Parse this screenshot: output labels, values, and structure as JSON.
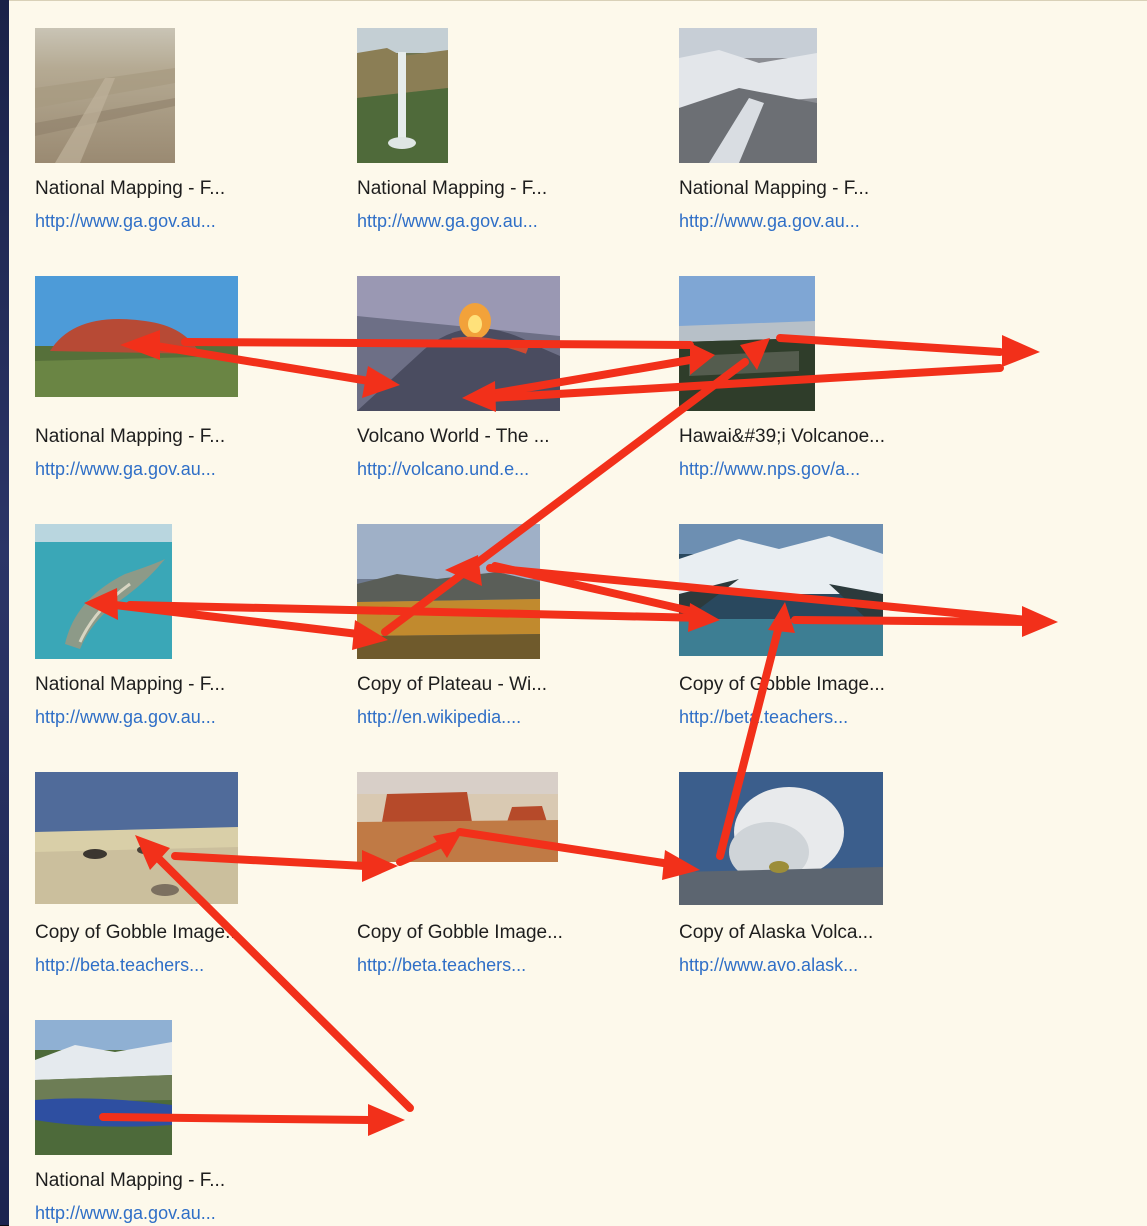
{
  "results": [
    {
      "title": "National Mapping - F...",
      "url": "http://www.ga.gov.au...",
      "image": "flat-desert-plain"
    },
    {
      "title": "National Mapping - F...",
      "url": "http://www.ga.gov.au...",
      "image": "waterfall-gorge"
    },
    {
      "title": "National Mapping - F...",
      "url": "http://www.ga.gov.au...",
      "image": "snowy-mountains"
    },
    {
      "title": "National Mapping - F...",
      "url": "http://www.ga.gov.au...",
      "image": "uluru-rock"
    },
    {
      "title": "Volcano World - The ...",
      "url": "http://volcano.und.e...",
      "image": "lava-flow"
    },
    {
      "title": "Hawai&#39;i Volcanoe...",
      "url": "http://www.nps.gov/a...",
      "image": "volcano-caldera"
    },
    {
      "title": "National Mapping - F...",
      "url": "http://www.ga.gov.au...",
      "image": "island-aerial"
    },
    {
      "title": "Copy of Plateau - Wi...",
      "url": "http://en.wikipedia....",
      "image": "plateau-landscape"
    },
    {
      "title": "Copy of Gobble Image...",
      "url": "http://beta.teachers...",
      "image": "fjord-glacier"
    },
    {
      "title": "Copy of Gobble Image...",
      "url": "http://beta.teachers...",
      "image": "dune-plain"
    },
    {
      "title": "Copy of Gobble Image...",
      "url": "http://beta.teachers...",
      "image": "red-mesa"
    },
    {
      "title": "Copy of Alaska Volca...",
      "url": "http://www.avo.alask...",
      "image": "volcano-eruption"
    },
    {
      "title": "National Mapping - F...",
      "url": "http://www.ga.gov.au...",
      "image": "mountain-lake"
    }
  ],
  "colors": {
    "panel_background": "#fdf9eb",
    "title_text": "#1e1e1e",
    "url_text": "#2f6fc7",
    "annotation_arrow": "#f2301a"
  },
  "annotation": "arrow-path"
}
